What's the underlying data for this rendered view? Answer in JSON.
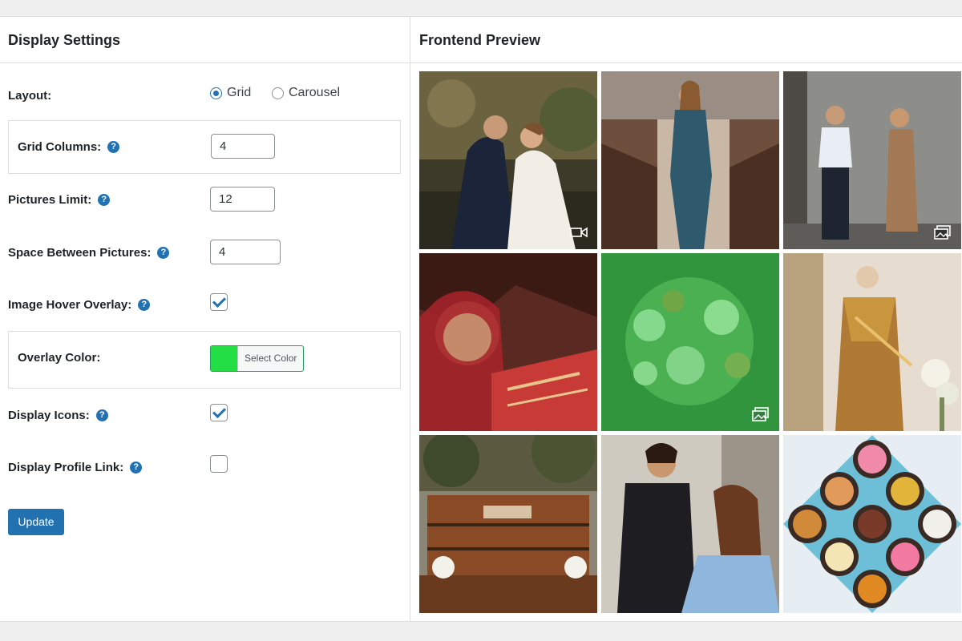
{
  "left_panel": {
    "title": "Display Settings"
  },
  "right_panel": {
    "title": "Frontend Preview"
  },
  "settings": {
    "layout": {
      "label": "Layout:",
      "options": [
        "Grid",
        "Carousel"
      ],
      "selected": "Grid"
    },
    "grid_columns": {
      "label": "Grid Columns:",
      "value": "4"
    },
    "pictures_limit": {
      "label": "Pictures Limit:",
      "value": "12"
    },
    "space_between": {
      "label": "Space Between Pictures:",
      "value": "4"
    },
    "hover_overlay": {
      "label": "Image Hover Overlay:",
      "checked": true
    },
    "overlay_color": {
      "label": "Overlay Color:",
      "button_label": "Select Color",
      "color": "#22dd44"
    },
    "display_icons": {
      "label": "Display Icons:",
      "checked": true
    },
    "profile_link": {
      "label": "Display Profile Link:",
      "checked": false
    },
    "update_label": "Update"
  },
  "help_glyph": "?",
  "colors": {
    "accent": "#2271b1",
    "overlay": "#22dd44"
  },
  "preview_tiles": [
    {
      "subject": "wedding couple kissing",
      "icon": "video-icon"
    },
    {
      "subject": "woman in teal dress in chapel",
      "icon": ""
    },
    {
      "subject": "couple by wall",
      "icon": "gallery-icon"
    },
    {
      "subject": "bride with jewelry",
      "icon": ""
    },
    {
      "subject": "flower bouquet with green overlay",
      "icon": "gallery-icon"
    },
    {
      "subject": "mannequin in golden dress",
      "icon": ""
    },
    {
      "subject": "outdoor wooden bar",
      "icon": ""
    },
    {
      "subject": "makeup artist",
      "icon": ""
    },
    {
      "subject": "box of sweets",
      "icon": ""
    }
  ]
}
